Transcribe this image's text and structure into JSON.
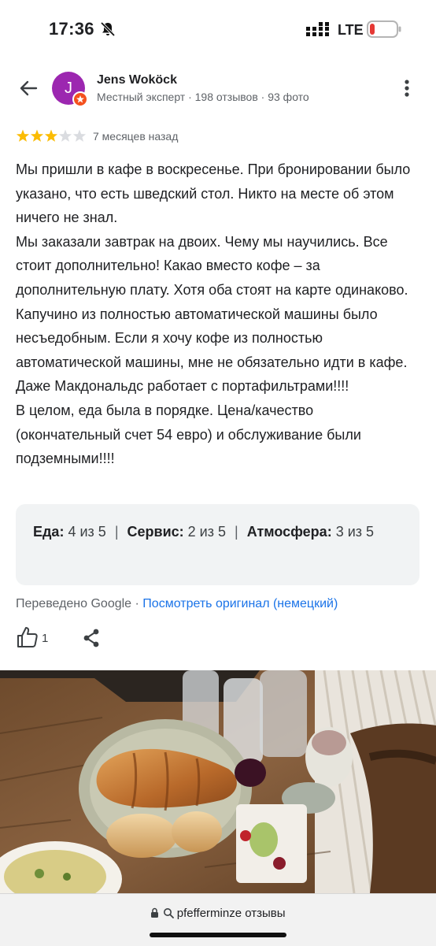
{
  "status_bar": {
    "time": "17:36",
    "network": "LTE",
    "icons": [
      "bell-off-icon",
      "signal-icon",
      "battery-low-icon"
    ],
    "battery_color": "#e53935"
  },
  "reviewer": {
    "avatar_letter": "J",
    "avatar_color": "#9c27b0",
    "name": "Jens Woköck",
    "meta": "Местный эксперт · 198 отзывов · 93 фото"
  },
  "review": {
    "rating": 3,
    "rating_max": 5,
    "date": "7 месяцев назад",
    "text": "Мы пришли в кафе в воскресенье. При бронировании было указано, что есть шведский стол. Никто на месте об этом ничего не знал.\nМы заказали завтрак на двоих. Чему мы научились. Все стоит дополнительно! Какао вместо кофе – за дополнительную плату. Хотя оба стоят на карте одинаково. Капучино из полностью автоматической машины было несъедобным. Если я хочу кофе из полностью автоматической машины, мне не обязательно идти в кафе. Даже Макдональдс работает с портафильтрами!!!!\nВ целом, еда была в порядке. Цена/качество (окончательный счет 54 евро) и обслуживание были подземными!!!!"
  },
  "sub_ratings": {
    "food_label": "Еда:",
    "food_value": "4 из 5",
    "service_label": "Сервис:",
    "service_value": "2 из 5",
    "atmosphere_label": "Атмосфера:",
    "atmosphere_value": "3 из 5",
    "separator": "|"
  },
  "translation": {
    "translated_by": "Переведено Google",
    "dot": " · ",
    "original_link": "Посмотреть оригинал (немецкий)",
    "link_color": "#1a73e8"
  },
  "actions": {
    "like_count": "1"
  },
  "browser": {
    "url": "pfefferminze отзывы"
  },
  "colors": {
    "star_filled": "#fbbc04",
    "star_empty": "#dadce0",
    "ratings_box_bg": "#f1f3f4"
  }
}
